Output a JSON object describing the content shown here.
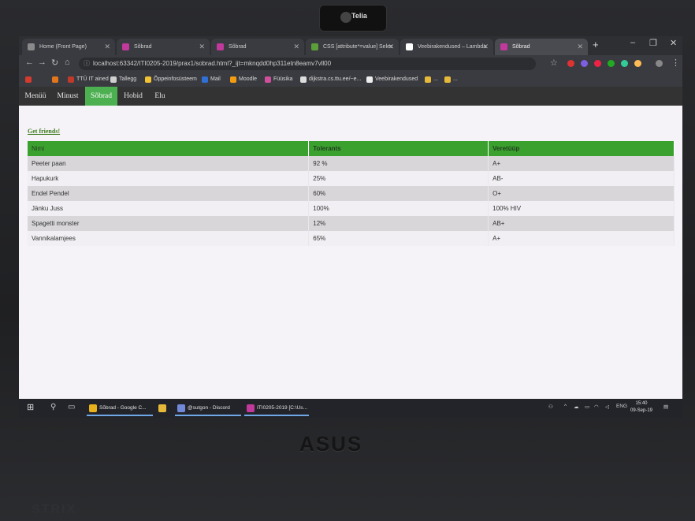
{
  "browser": {
    "tabs": [
      {
        "label": "Home (Front Page)",
        "icon_color": "#8a8a8a"
      },
      {
        "label": "Sõbrad",
        "icon_color": "#c0399b"
      },
      {
        "label": "Sõbrad",
        "icon_color": "#c0399b"
      },
      {
        "label": "CSS [attribute*=value] Selec",
        "icon_color": "#5c9e3a"
      },
      {
        "label": "Veebirakendused – Lambda",
        "icon_color": "#ffffff"
      },
      {
        "label": "Sõbrad",
        "icon_color": "#c0399b"
      }
    ],
    "new_tab": "+",
    "window_controls": {
      "minimize": "–",
      "maximize": "❐",
      "close": "✕"
    },
    "url": "localhost:63342/ITI0205-2019/prax1/sobrad.html?_ijt=mknqdd0hp311etn8eamv7vll00",
    "bookmarks": [
      {
        "label": "",
        "icon_color": "#d43b2f"
      },
      {
        "label": "",
        "icon_color": "#e2761b"
      },
      {
        "label": "TTÜ IT ained",
        "icon_color": "#c0392b"
      },
      {
        "label": "Tallegg",
        "icon_color": "#cfcfcf"
      },
      {
        "label": "Õppeinfosüsteem",
        "icon_color": "#f1c232"
      },
      {
        "label": "Mail",
        "icon_color": "#2f6fd6"
      },
      {
        "label": "Moodle",
        "icon_color": "#f39c12"
      },
      {
        "label": "Füüsika",
        "icon_color": "#d04f9a"
      },
      {
        "label": "dijkstra.cs.ttu.ee/~e...",
        "icon_color": "#dddddd"
      },
      {
        "label": "Veebirakendused",
        "icon_color": "#eeeeee"
      },
      {
        "label": "...",
        "icon_color": "#e6b93a"
      },
      {
        "label": "...",
        "icon_color": "#e6b93a"
      }
    ],
    "extensions": [
      "#d33",
      "#7c5ee0",
      "#e24",
      "#2a2",
      "#3c9",
      "#fb5",
      "#888"
    ]
  },
  "nav": {
    "items": [
      "Menüü",
      "Minust",
      "Sõbrad",
      "Hobid",
      "Elu"
    ],
    "active": "Sõbrad"
  },
  "page": {
    "link": "Get friends!",
    "table": {
      "headers": [
        "Nimi",
        "Tolerants",
        "Veretüüp"
      ],
      "rows": [
        [
          "Peeter paan",
          "92 %",
          "A+"
        ],
        [
          "Hapukurk",
          "25%",
          "AB-"
        ],
        [
          "Endel Pendel",
          "60%",
          "O+"
        ],
        [
          "Jänku Juss",
          "100%",
          "100% HIV"
        ],
        [
          "Spagetti monster",
          "12%",
          "AB+"
        ],
        [
          "Vannikalamjees",
          "65%",
          "A+"
        ]
      ]
    }
  },
  "taskbar": {
    "apps": [
      {
        "label": "Sõbrad - Google C...",
        "icon_color": "#e8b21a"
      },
      {
        "label": "",
        "icon_color": "#e6b93a"
      },
      {
        "label": "@sutgon - Discord",
        "icon_color": "#7289da"
      },
      {
        "label": "ITI0205-2019 [C:\\Us...",
        "icon_color": "#c0399b"
      }
    ],
    "language": "ENG",
    "time": "15:40",
    "date": "09-Sep-19"
  },
  "hardware": {
    "camera_brand": "Telia",
    "laptop_brand": "ASUS",
    "series": "STRIX"
  }
}
